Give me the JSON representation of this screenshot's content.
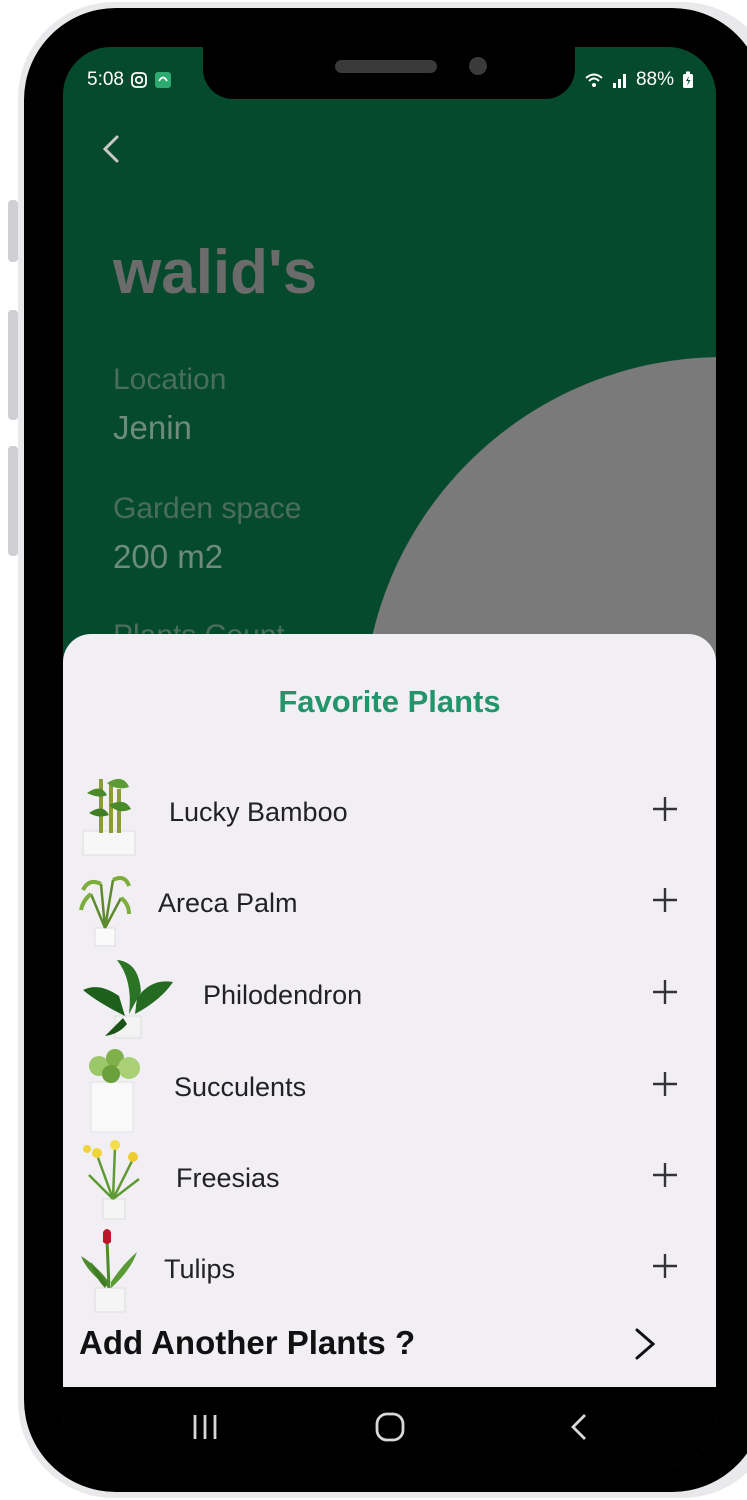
{
  "status_bar": {
    "time": "5:08",
    "battery": "88%",
    "left_icons": [
      "instagram-icon",
      "app-notification-icon"
    ],
    "right_icons": [
      "wifi-icon",
      "signal-icon",
      "battery-icon"
    ]
  },
  "garden": {
    "name": "walid's",
    "fields": [
      {
        "label": "Location",
        "value": "Jenin"
      },
      {
        "label": "Garden space",
        "value": "200 m2"
      },
      {
        "label": "Plants Count",
        "value": ""
      }
    ]
  },
  "favorites": {
    "title": "Favorite Plants",
    "plants": [
      {
        "name": "Lucky Bamboo",
        "action_icon": "plus-icon"
      },
      {
        "name": "Areca Palm",
        "action_icon": "plus-icon"
      },
      {
        "name": "Philodendron",
        "action_icon": "plus-icon"
      },
      {
        "name": "Succulents",
        "action_icon": "plus-icon"
      },
      {
        "name": "Freesias",
        "action_icon": "plus-icon"
      },
      {
        "name": "Tulips",
        "action_icon": "plus-icon"
      }
    ],
    "add_another": "Add Another Plants ?"
  },
  "nav_bar": [
    "recent-apps-icon",
    "home-icon",
    "back-icon"
  ],
  "colors": {
    "header_bg": "#064a2d",
    "sheet_bg": "#f2eff4",
    "title_green": "#22956a",
    "accent_grey": "#7a7a7a"
  }
}
